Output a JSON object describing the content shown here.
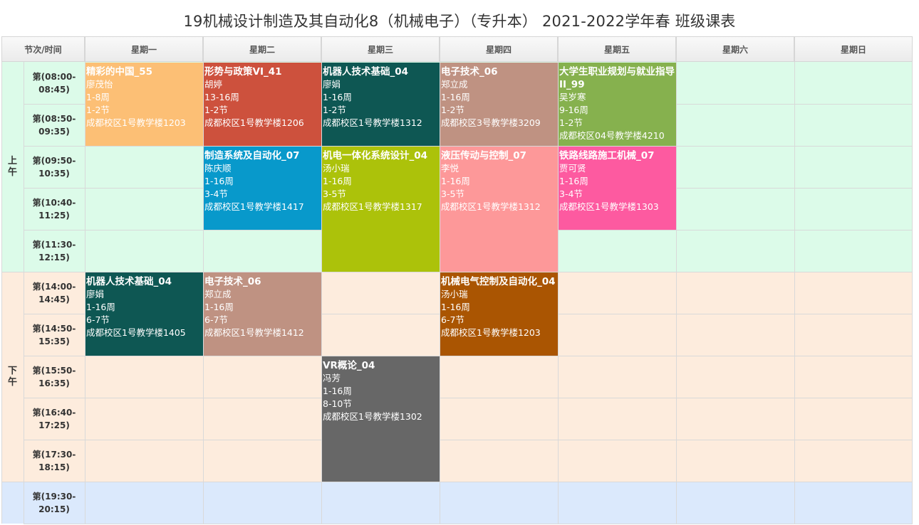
{
  "title": "19机械设计制造及其自动化8（机械电子）（专升本） 2021-2022学年春 班级课表",
  "header": {
    "corner": "节次/时间",
    "days": [
      "星期一",
      "星期二",
      "星期三",
      "星期四",
      "星期五",
      "星期六",
      "星期日"
    ]
  },
  "periods": {
    "morning": "上\n午",
    "afternoon": "下\n午"
  },
  "slots": [
    [
      "第(08:00-",
      "08:45)"
    ],
    [
      "第(08:50-",
      "09:35)"
    ],
    [
      "第(09:50-",
      "10:35)"
    ],
    [
      "第(10:40-",
      "11:25)"
    ],
    [
      "第(11:30-",
      "12:15)"
    ],
    [
      "第(14:00-",
      "14:45)"
    ],
    [
      "第(14:50-",
      "15:35)"
    ],
    [
      "第(15:50-",
      "16:35)"
    ],
    [
      "第(16:40-",
      "17:25)"
    ],
    [
      "第(17:30-",
      "18:15)"
    ],
    [
      "第(19:30-",
      "20:15)"
    ]
  ],
  "colors": {
    "morning_bg": "#dcfbe9",
    "afternoon_bg": "#fdecdd",
    "evening_bg": "#dbe9fc"
  },
  "courses": [
    {
      "day": 0,
      "start": 0,
      "span": 2,
      "color": "#fcbf75",
      "name": "精彩的中国_55",
      "teacher": "廖茂怡",
      "weeks": "1-8周",
      "sections": "1-2节",
      "room": "成都校区1号教学楼1203"
    },
    {
      "day": 1,
      "start": 0,
      "span": 2,
      "color": "#cd513d",
      "name": "形势与政策VI_41",
      "teacher": "胡婷",
      "weeks": "13-16周",
      "sections": "1-2节",
      "room": "成都校区1号教学楼1206"
    },
    {
      "day": 2,
      "start": 0,
      "span": 2,
      "color": "#0e5753",
      "name": "机器人技术基础_04",
      "teacher": "廖娟",
      "weeks": "1-16周",
      "sections": "1-2节",
      "room": "成都校区1号教学楼1312"
    },
    {
      "day": 3,
      "start": 0,
      "span": 2,
      "color": "#bf9282",
      "name": "电子技术_06",
      "teacher": "郑立成",
      "weeks": "1-16周",
      "sections": "1-2节",
      "room": "成都校区3号教学楼3209"
    },
    {
      "day": 4,
      "start": 0,
      "span": 2,
      "color": "#86b14e",
      "name": "大学生职业规划与就业指导II_99",
      "teacher": "吴岁寒",
      "weeks": "9-16周",
      "sections": "1-2节",
      "room": "成都校区04号教学楼4210"
    },
    {
      "day": 1,
      "start": 2,
      "span": 2,
      "color": "#0899cb",
      "name": "制造系统及自动化_07",
      "teacher": "陈庆顺",
      "weeks": "1-16周",
      "sections": "3-4节",
      "room": "成都校区1号教学楼1417"
    },
    {
      "day": 2,
      "start": 2,
      "span": 3,
      "color": "#acc20a",
      "name": "机电一体化系统设计_04",
      "teacher": "汤小瑞",
      "weeks": "1-16周",
      "sections": "3-5节",
      "room": "成都校区1号教学楼1317"
    },
    {
      "day": 3,
      "start": 2,
      "span": 3,
      "color": "#fd9899",
      "name": "液压传动与控制_07",
      "teacher": "李悦",
      "weeks": "1-16周",
      "sections": "3-5节",
      "room": "成都校区1号教学楼1312"
    },
    {
      "day": 4,
      "start": 2,
      "span": 2,
      "color": "#fd5aa0",
      "name": "铁路线路施工机械_07",
      "teacher": "贾可贤",
      "weeks": "1-16周",
      "sections": "3-4节",
      "room": "成都校区1号教学楼1303"
    },
    {
      "day": 0,
      "start": 5,
      "span": 2,
      "color": "#0e5753",
      "name": "机器人技术基础_04",
      "teacher": "廖娟",
      "weeks": "1-16周",
      "sections": "6-7节",
      "room": "成都校区1号教学楼1405"
    },
    {
      "day": 1,
      "start": 5,
      "span": 2,
      "color": "#bf9282",
      "name": "电子技术_06",
      "teacher": "郑立成",
      "weeks": "1-16周",
      "sections": "6-7节",
      "room": "成都校区1号教学楼1412"
    },
    {
      "day": 3,
      "start": 5,
      "span": 2,
      "color": "#aa5502",
      "name": "机械电气控制及自动化_04",
      "teacher": "汤小瑞",
      "weeks": "1-16周",
      "sections": "6-7节",
      "room": "成都校区1号教学楼1203"
    },
    {
      "day": 2,
      "start": 7,
      "span": 3,
      "color": "#676767",
      "name": "VR概论_04",
      "teacher": "冯芳",
      "weeks": "1-16周",
      "sections": "8-10节",
      "room": "成都校区1号教学楼1302"
    }
  ]
}
